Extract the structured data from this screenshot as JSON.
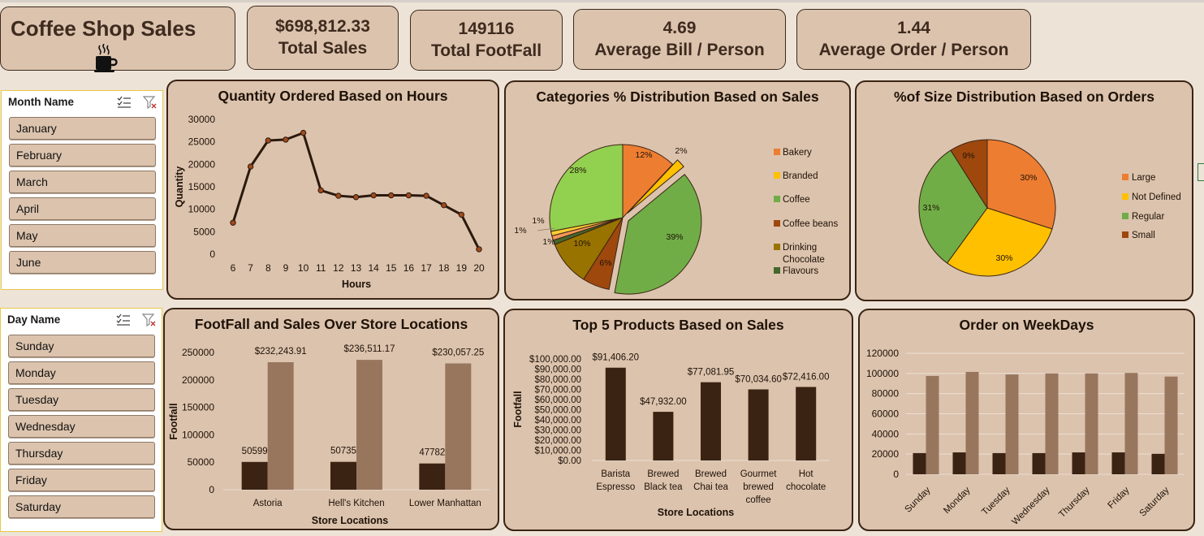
{
  "title": "Coffee Shop Sales",
  "kpis": [
    {
      "value": "$698,812.33",
      "label": "Total Sales"
    },
    {
      "value": "149116",
      "label": "Total FootFall"
    },
    {
      "value": "4.69",
      "label": "Average Bill / Person"
    },
    {
      "value": "1.44",
      "label": "Average Order / Person"
    }
  ],
  "slicers": {
    "month": {
      "header": "Month Name",
      "items": [
        "January",
        "February",
        "March",
        "April",
        "May",
        "June"
      ]
    },
    "day": {
      "header": "Day Name",
      "items": [
        "Sunday",
        "Monday",
        "Tuesday",
        "Wednesday",
        "Thursday",
        "Friday",
        "Saturday"
      ]
    }
  },
  "chart_data": [
    {
      "id": "hours",
      "type": "line",
      "title": "Quantity Ordered Based on Hours",
      "xlabel": "Hours",
      "ylabel": "Quantity",
      "x": [
        6,
        7,
        8,
        9,
        10,
        11,
        12,
        13,
        14,
        15,
        16,
        17,
        18,
        19,
        20
      ],
      "y": [
        7000,
        19500,
        25300,
        25500,
        27000,
        14200,
        13000,
        12700,
        13100,
        13100,
        13100,
        13000,
        10900,
        8800,
        1100
      ],
      "yticks": [
        0,
        5000,
        10000,
        15000,
        20000,
        25000,
        30000
      ],
      "ylim": [
        0,
        30000
      ],
      "colors": {
        "line": "#2b190e",
        "marker": "#a14a1b"
      }
    },
    {
      "id": "categories",
      "type": "pie",
      "title": "Categories % Distribution Based on Sales",
      "slices": [
        {
          "label": "Bakery",
          "value": 12,
          "color": "#ed7d31",
          "text": "12%"
        },
        {
          "label": "Branded",
          "value": 2,
          "color": "#ffc000",
          "text": "2%"
        },
        {
          "label": "Coffee",
          "value": 39,
          "color": "#70ad47",
          "text": "39%"
        },
        {
          "label": "Coffee beans",
          "value": 6,
          "color": "#9e480e",
          "text": "6%"
        },
        {
          "label": "Drinking Chocolate",
          "value": 10,
          "color": "#997300",
          "text": "10%"
        },
        {
          "label": "Flavours",
          "value": 1,
          "color": "#43682b",
          "text": "1%"
        },
        {
          "label": "",
          "value": 1,
          "color": "#f1975a",
          "text": "1%"
        },
        {
          "label": "",
          "value": 1,
          "color": "#ffcd33",
          "text": "1%"
        },
        {
          "label": "",
          "value": 28,
          "color": "#92d050",
          "text": "28%"
        }
      ],
      "legend": [
        "Bakery",
        "Branded",
        "Coffee",
        "Coffee beans",
        "Drinking Chocolate",
        "Flavours"
      ],
      "legend_position": "right"
    },
    {
      "id": "size",
      "type": "pie",
      "title": "%of Size Distribution Based on Orders",
      "slices": [
        {
          "label": "Large",
          "value": 30,
          "color": "#ed7d31",
          "text": "30%"
        },
        {
          "label": "Not Defined",
          "value": 30,
          "color": "#ffc000",
          "text": "30%"
        },
        {
          "label": "Regular",
          "value": 31,
          "color": "#70ad47",
          "text": "31%"
        },
        {
          "label": "Small",
          "value": 9,
          "color": "#9e480e",
          "text": "9%"
        }
      ],
      "legend": [
        "Large",
        "Not Defined",
        "Regular",
        "Small"
      ],
      "legend_position": "right"
    },
    {
      "id": "locations",
      "type": "bar",
      "title": "FootFall and Sales Over Store Locations",
      "xlabel": "Store Locations",
      "ylabel": "Footfall",
      "categories": [
        "Astoria",
        "Hell's Kitchen",
        "Lower Manhattan"
      ],
      "series": [
        {
          "values": [
            50599,
            50735,
            47782
          ],
          "labels": [
            "50599",
            "50735",
            "47782"
          ],
          "color": "#3b2314"
        },
        {
          "values": [
            232243.91,
            236511.17,
            230057.25
          ],
          "labels": [
            "$232,243.91",
            "$236,511.17",
            "$230,057.25"
          ],
          "color": "#98765e"
        }
      ],
      "yticks": [
        0,
        50000,
        100000,
        150000,
        200000,
        250000
      ],
      "ylim": [
        0,
        250000
      ]
    },
    {
      "id": "products",
      "type": "bar",
      "title": "Top 5 Products Based on Sales",
      "xlabel": "Store Locations",
      "ylabel": "Footfall",
      "categories": [
        [
          "Barista",
          "Espresso"
        ],
        [
          "Brewed",
          "Black tea"
        ],
        [
          "Brewed",
          "Chai tea"
        ],
        [
          "Gourmet",
          "brewed",
          "coffee"
        ],
        [
          "Hot",
          "chocolate"
        ]
      ],
      "values": [
        91406.2,
        47932.0,
        77081.95,
        70034.6,
        72416.0
      ],
      "labels": [
        "$91,406.20",
        "$47,932.00",
        "$77,081.95",
        "$70,034.60",
        "$72,416.00"
      ],
      "yticks": [
        "$0.00",
        "$10,000.00",
        "$20,000.00",
        "$30,000.00",
        "$40,000.00",
        "$50,000.00",
        "$60,000.00",
        "$70,000.00",
        "$80,000.00",
        "$90,000.00",
        "$100,000.00"
      ],
      "ylim": [
        0,
        100000
      ],
      "color": "#3b2314"
    },
    {
      "id": "weekdays",
      "type": "bar",
      "title": "Order on WeekDays",
      "categories": [
        "Sunday",
        "Monday",
        "Tuesday",
        "Wednesday",
        "Thursday",
        "Friday",
        "Saturday"
      ],
      "series": [
        {
          "values": [
            21000,
            21700,
            21000,
            21000,
            21700,
            21700,
            20300
          ],
          "color": "#3b2314"
        },
        {
          "values": [
            97500,
            101500,
            99000,
            100000,
            100000,
            100500,
            96900
          ],
          "color": "#98765e"
        }
      ],
      "yticks": [
        0,
        20000,
        40000,
        60000,
        80000,
        100000,
        120000
      ],
      "ylim": [
        0,
        120000
      ],
      "grid": true
    }
  ]
}
